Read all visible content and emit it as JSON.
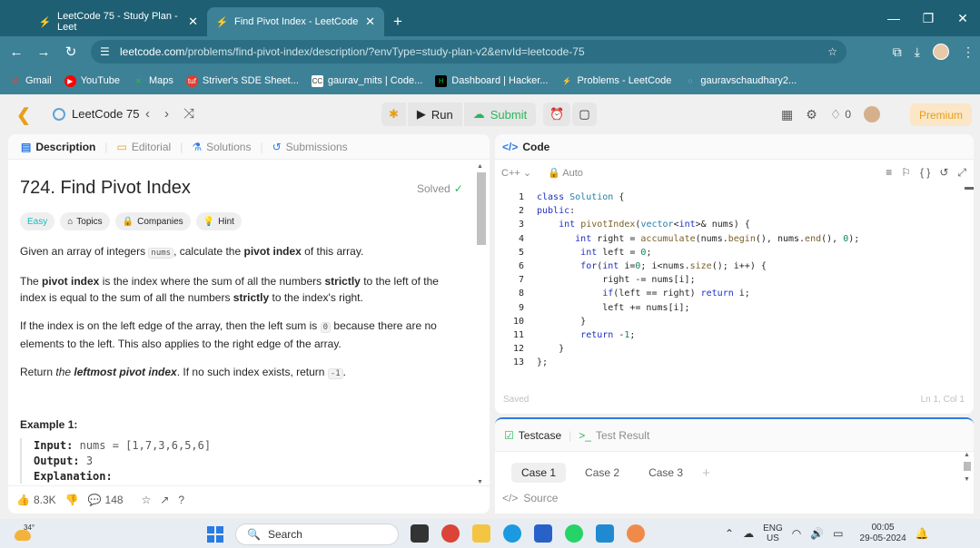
{
  "browser": {
    "tabs": [
      {
        "title": "LeetCode 75 - Study Plan - Leet",
        "close": "✕"
      },
      {
        "title": "Find Pivot Index - LeetCode",
        "close": "✕"
      }
    ],
    "new_tab": "+",
    "url_main": "leetcode.com",
    "url_path": "/problems/find-pivot-index/description/?envType=study-plan-v2&envId=leetcode-75",
    "bookmarks": [
      {
        "label": "Gmail",
        "color": "#ea4335"
      },
      {
        "label": "YouTube",
        "color": "#ff0000"
      },
      {
        "label": "Maps",
        "color": "#34a853"
      },
      {
        "label": "Striver's SDE Sheet...",
        "color": "#e23b2e"
      },
      {
        "label": "gaurav_mits | Code...",
        "color": "#ffffff"
      },
      {
        "label": "Dashboard | Hacker...",
        "color": "#1ba94c"
      },
      {
        "label": "Problems - LeetCode",
        "color": "#ffa116"
      },
      {
        "label": "gauravschaudhary2...",
        "color": "#3d8197"
      }
    ]
  },
  "leetcode": {
    "study_plan": "LeetCode 75",
    "run_label": "Run",
    "submit_label": "Submit",
    "coins": "0",
    "premium_label": "Premium",
    "accent": "#ffa116",
    "submit_color": "#2db55d"
  },
  "description_tabs": [
    "Description",
    "Editorial",
    "Solutions",
    "Submissions"
  ],
  "problem": {
    "title": "724. Find Pivot Index",
    "solved": "Solved",
    "tags": [
      "Easy",
      "Topics",
      "Companies",
      "Hint"
    ],
    "p1_a": "Given an array of integers ",
    "p1_code": "nums",
    "p1_b": ", calculate the ",
    "p1_bold": "pivot index",
    "p1_c": " of this array.",
    "p2_a": "The ",
    "p2_bold1": "pivot index",
    "p2_b": " is the index where the sum of all the numbers ",
    "p2_bold2": "strictly",
    "p2_c": " to the left of the index is equal to the sum of all the numbers ",
    "p2_bold3": "strictly",
    "p2_d": " to the index's right.",
    "p3_a": "If the index is on the left edge of the array, then the left sum is ",
    "p3_code": "0",
    "p3_b": " because there are no elements to the left. This also applies to the right edge of the array.",
    "p4_a": "Return ",
    "p4_the": "the ",
    "p4_bold": "leftmost pivot index",
    "p4_b": ". If no such index exists, return ",
    "p4_code": "-1",
    "p4_c": ".",
    "example_title": "Example 1:",
    "ex_input_label": "Input:",
    "ex_input_value": "nums = [1,7,3,6,5,6]",
    "ex_output_label": "Output:",
    "ex_output_value": "3",
    "ex_expl_label": "Explanation:"
  },
  "footer": {
    "likes": "8.3K",
    "comments": "148"
  },
  "editor": {
    "header": "Code",
    "language": "C++",
    "mode": "Auto",
    "saved": "Saved",
    "cursor": "Ln 1, Col 1",
    "line_numbers": [
      "1",
      "2",
      "3",
      "4",
      "5",
      "6",
      "7",
      "8",
      "9",
      "10",
      "11",
      "12",
      "13"
    ]
  },
  "testcase": {
    "tab_testcase": "Testcase",
    "tab_result": "Test Result",
    "cases": [
      "Case 1",
      "Case 2",
      "Case 3"
    ],
    "source": "Source"
  },
  "taskbar": {
    "temp": "34°",
    "search": "Search",
    "lang1": "ENG",
    "lang2": "US",
    "time": "00:05",
    "date": "29-05-2024"
  }
}
